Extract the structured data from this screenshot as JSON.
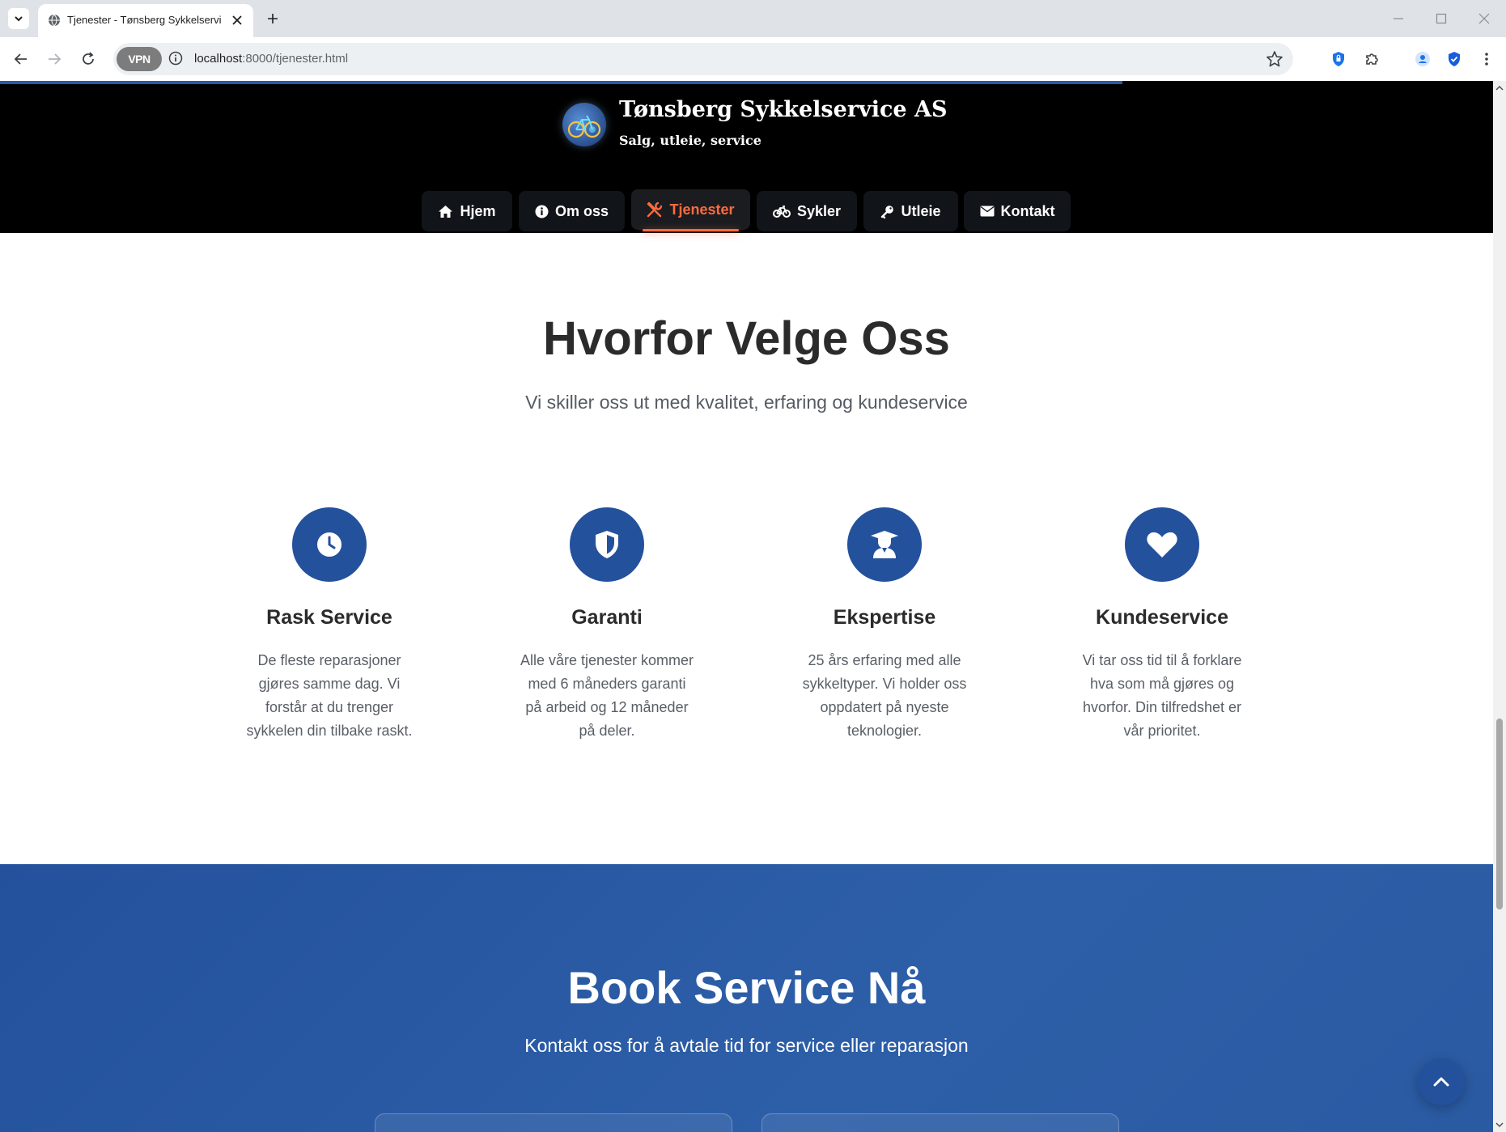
{
  "browser": {
    "tab_title": "Tjenester - Tønsberg Sykkelservice AS",
    "url_host": "localhost",
    "url_rest": ":8000/tjenester.html",
    "vpn_label": "VPN"
  },
  "site": {
    "brand_name": "Tønsberg Sykkelservice AS",
    "tagline": "Salg, utleie, service",
    "nav": [
      {
        "label": "Hjem",
        "icon": "home-icon"
      },
      {
        "label": "Om oss",
        "icon": "info-icon"
      },
      {
        "label": "Tjenester",
        "icon": "tools-icon",
        "active": true
      },
      {
        "label": "Sykler",
        "icon": "bicycle-icon"
      },
      {
        "label": "Utleie",
        "icon": "key-icon"
      },
      {
        "label": "Kontakt",
        "icon": "envelope-icon"
      }
    ]
  },
  "why": {
    "title": "Hvorfor Velge Oss",
    "subtitle": "Vi skiller oss ut med kvalitet, erfaring og kundeservice",
    "features": [
      {
        "icon": "clock-icon",
        "title": "Rask Service",
        "text": "De fleste reparasjoner gjøres samme dag. Vi forstår at du trenger sykkelen din tilbake raskt."
      },
      {
        "icon": "shield-icon",
        "title": "Garanti",
        "text": "Alle våre tjenester kommer med 6 måneders garanti på arbeid og 12 måneder på deler."
      },
      {
        "icon": "graduate-icon",
        "title": "Ekspertise",
        "text": "25 års erfaring med alle sykkeltyper. Vi holder oss oppdatert på nyeste teknologier."
      },
      {
        "icon": "heart-icon",
        "title": "Kundeservice",
        "text": "Vi tar oss tid til å forklare hva som må gjøres og hvorfor. Din tilfredshet er vår prioritet."
      }
    ]
  },
  "book": {
    "title": "Book Service Nå",
    "subtitle": "Kontakt oss for å avtale tid for service eller reparasjon"
  },
  "colors": {
    "primary": "#24519c",
    "accent": "#ff6b3d",
    "header_bg": "#000000"
  }
}
